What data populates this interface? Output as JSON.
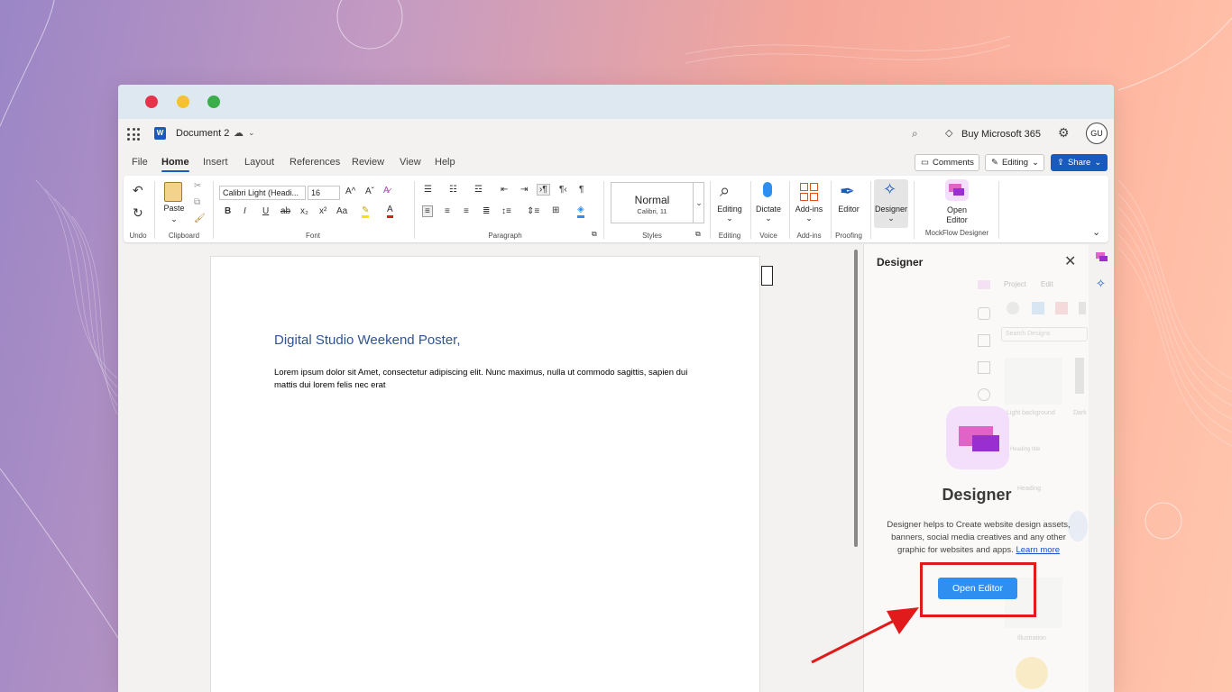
{
  "window": {
    "traffic_lights": {
      "close": "#e5334b",
      "minimize": "#f6c12f",
      "zoom": "#3bad4b"
    }
  },
  "appbar": {
    "app_icon": "word-icon",
    "word_letter": "W",
    "doc_title": "Document 2",
    "buy_label": "Buy Microsoft 365",
    "avatar_initials": "GU"
  },
  "menu": {
    "items": [
      "File",
      "Home",
      "Insert",
      "Layout",
      "References",
      "Review",
      "View",
      "Help"
    ],
    "active": "Home",
    "comments_label": "Comments",
    "editing_label": "Editing",
    "share_label": "Share"
  },
  "ribbon": {
    "undo_label": "Undo",
    "paste_label": "Paste",
    "clipboard_label": "Clipboard",
    "font_name": "Calibri Light (Headi...",
    "font_size": "16",
    "font_label": "Font",
    "paragraph_label": "Paragraph",
    "style_name": "Normal",
    "style_font": "Calibri, 11",
    "styles_label": "Styles",
    "editing_btn": "Editing",
    "editing_group": "Editing",
    "dictate_btn": "Dictate",
    "voice_group": "Voice",
    "addins_btn": "Add-ins",
    "addins_group": "Add-ins",
    "editor_btn": "Editor",
    "proofing_group": "Proofing",
    "designer_btn": "Designer",
    "open_editor_btn_line1": "Open",
    "open_editor_btn_line2": "Editor",
    "mockflow_group": "MockFlow Designer",
    "format_glyphs": {
      "bold": "B",
      "italic": "I",
      "underline": "U",
      "strike": "ab",
      "subscript": "x₂",
      "superscript": "x²",
      "case": "Aa",
      "grow": "A^",
      "shrink": "Aˇ",
      "pilcrow": "¶"
    }
  },
  "document": {
    "heading": "Digital Studio Weekend Poster,",
    "body": "Lorem ipsum dolor sit Amet, consectetur adipiscing elit. Nunc maximus, nulla ut commodo sagittis, sapien dui mattis dui lorem felis nec erat"
  },
  "designer_pane": {
    "title": "Designer",
    "ghost_tabs": [
      "Project",
      "Edit"
    ],
    "ghost_search": "Search Designs",
    "ghost_labels": [
      "Light background",
      "Dark",
      "Heading title",
      "Heading",
      "Illustration"
    ],
    "product_name": "Designer",
    "description": "Designer helps to Create website design assets, banners, social media creatives and any other graphic for websites and apps.",
    "learn_more": "Learn more",
    "open_editor": "Open Editor"
  },
  "annotation": {
    "highlight_color": "#e11b1b"
  }
}
